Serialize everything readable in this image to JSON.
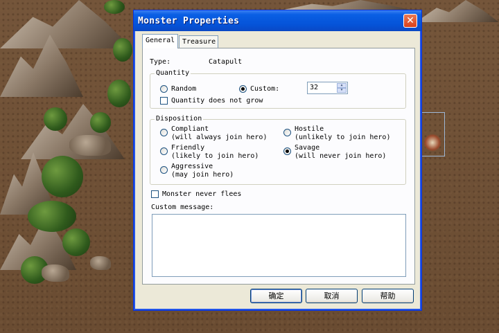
{
  "window": {
    "title": "Monster Properties",
    "close_glyph": "✕"
  },
  "tabs": [
    {
      "label": "General",
      "selected": true
    },
    {
      "label": "Treasure",
      "selected": false
    }
  ],
  "general": {
    "type_label": "Type:",
    "type_value": "Catapult",
    "quantity": {
      "group_label": "Quantity",
      "random_label": "Random",
      "random_selected": false,
      "custom_label": "Custom:",
      "custom_selected": true,
      "custom_value": "32",
      "not_grow_label": "Quantity does not grow",
      "not_grow_checked": false
    },
    "disposition": {
      "group_label": "Disposition",
      "options": [
        {
          "label": "Compliant",
          "note": "(will always join hero)",
          "selected": false
        },
        {
          "label": "Hostile",
          "note": "(unlikely to join hero)",
          "selected": false
        },
        {
          "label": "Friendly",
          "note": "(likely to join hero)",
          "selected": false
        },
        {
          "label": "Savage",
          "note": "(will never join hero)",
          "selected": true
        },
        {
          "label": "Aggressive",
          "note": "(may join hero)",
          "selected": false
        }
      ]
    },
    "never_flees_label": "Monster never flees",
    "never_flees_checked": false,
    "custom_message_label": "Custom message:",
    "custom_message_value": ""
  },
  "buttons": {
    "ok": "确定",
    "cancel": "取消",
    "help": "帮助"
  },
  "icons": {
    "close": "close-icon",
    "spin_up": "up-arrow-icon",
    "spin_down": "down-arrow-icon"
  },
  "colors": {
    "titlebar": "#0553d8",
    "dialog_bg": "#ece9d8",
    "map_ground": "#6b4e33"
  }
}
